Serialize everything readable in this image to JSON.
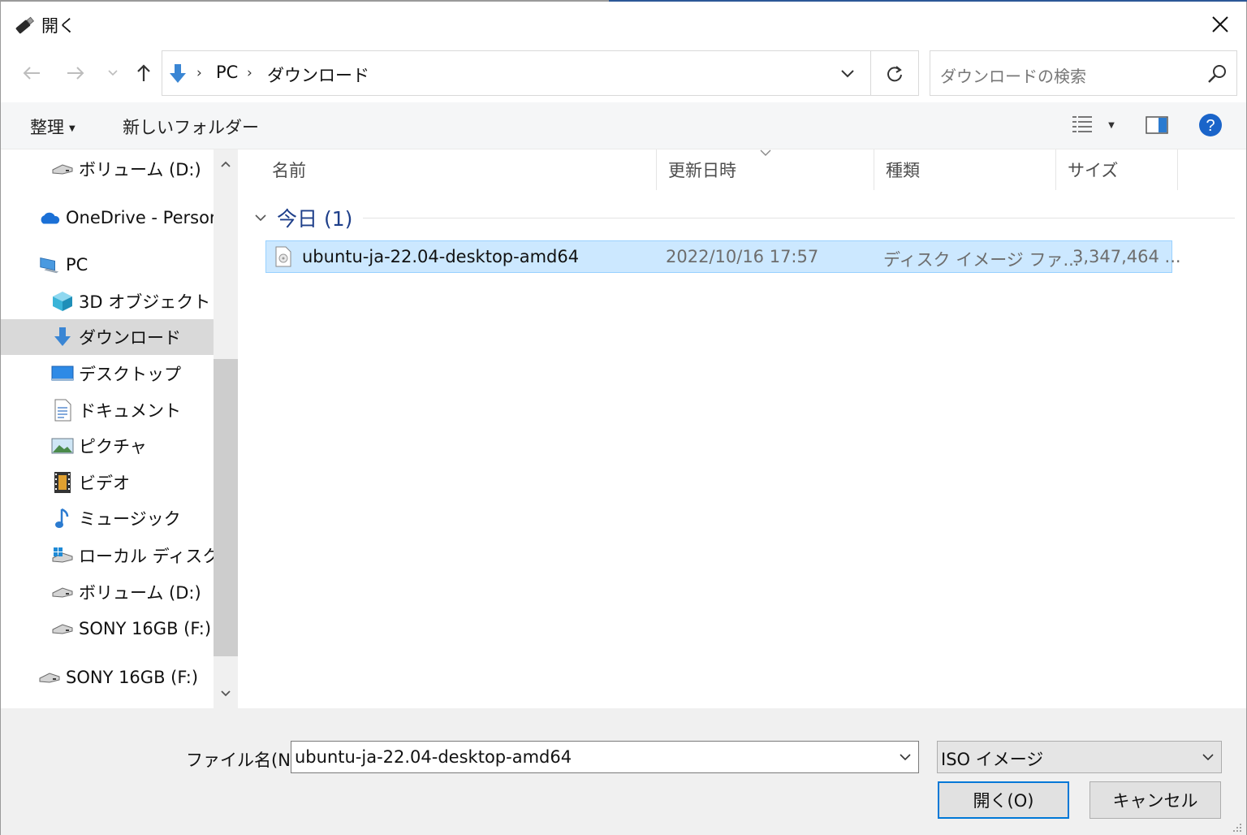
{
  "window": {
    "title": "開く",
    "accent_color": "#0078d7"
  },
  "nav": {
    "breadcrumb": [
      "PC",
      "ダウンロード"
    ],
    "search_placeholder": "ダウンロードの検索"
  },
  "toolbar": {
    "organize_label": "整理",
    "new_folder_label": "新しいフォルダー"
  },
  "sidebar": {
    "items": [
      {
        "label": "ボリューム (D:)",
        "icon": "drive-icon"
      },
      {
        "label": "OneDrive - Persor",
        "icon": "onedrive-cloud-icon"
      },
      {
        "label": "PC",
        "icon": "pc-icon"
      },
      {
        "label": "3D オブジェクト",
        "icon": "3d-objects-icon"
      },
      {
        "label": "ダウンロード",
        "icon": "download-arrow-icon",
        "selected": true
      },
      {
        "label": "デスクトップ",
        "icon": "desktop-icon"
      },
      {
        "label": "ドキュメント",
        "icon": "document-icon"
      },
      {
        "label": "ピクチャ",
        "icon": "pictures-icon"
      },
      {
        "label": "ビデオ",
        "icon": "video-icon"
      },
      {
        "label": "ミュージック",
        "icon": "music-icon"
      },
      {
        "label": "ローカル ディスク (C:",
        "icon": "local-disk-icon"
      },
      {
        "label": "ボリューム (D:)",
        "icon": "drive-icon"
      },
      {
        "label": "SONY 16GB (F:)",
        "icon": "drive-icon"
      },
      {
        "label": "SONY 16GB (F:)",
        "icon": "drive-icon"
      }
    ]
  },
  "columns": {
    "name": "名前",
    "modified": "更新日時",
    "type": "種類",
    "size": "サイズ"
  },
  "group": {
    "title": "今日 (1)"
  },
  "files": [
    {
      "name": "ubuntu-ja-22.04-desktop-amd64",
      "modified": "2022/10/16 17:57",
      "type": "ディスク イメージ ファ...",
      "size": "3,347,464 ..."
    }
  ],
  "footer": {
    "filename_label": "ファイル名(N):",
    "filename_value": "ubuntu-ja-22.04-desktop-amd64",
    "filetype_value": "ISO イメージ",
    "open_label": "開く(O)",
    "cancel_label": "キャンセル"
  }
}
